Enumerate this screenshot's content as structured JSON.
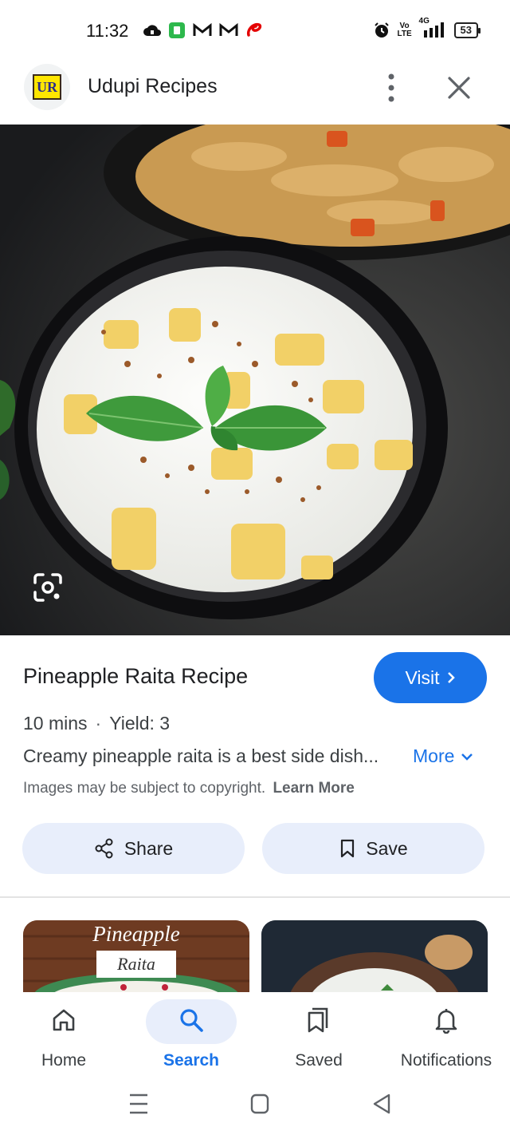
{
  "status_bar": {
    "time": "11:32",
    "notification_icons": [
      "cloud-upload-icon",
      "green-app-icon",
      "gmail-icon",
      "gmail-icon",
      "airtel-icon"
    ],
    "right_icons": [
      "alarm-icon",
      "volte-icon",
      "4g-signal-icon"
    ],
    "volte": "Vo LTE",
    "network": "4G",
    "battery": "53"
  },
  "header": {
    "logo_text": "UR",
    "site_name": "Udupi Recipes",
    "menu_icon": "more-vert-icon",
    "close_icon": "close-icon"
  },
  "hero": {
    "lens_icon": "google-lens-icon"
  },
  "recipe": {
    "title": "Pineapple Raita Recipe",
    "visit_label": "Visit",
    "time": "10 mins",
    "separator": "·",
    "yield": "Yield: 3",
    "description": "Creamy pineapple raita is a best side dish...",
    "more_label": "More",
    "copyright_text": "Images may be subject to copyright.",
    "learn_more": "Learn More"
  },
  "actions": {
    "share_label": "Share",
    "save_label": "Save"
  },
  "related": {
    "thumb1_title": "Pineapple",
    "thumb1_subtitle": "Raita"
  },
  "bottom_nav": {
    "items": [
      {
        "label": "Home",
        "icon": "home-icon"
      },
      {
        "label": "Search",
        "icon": "search-icon"
      },
      {
        "label": "Saved",
        "icon": "saved-icon"
      },
      {
        "label": "Notifications",
        "icon": "bell-icon"
      }
    ],
    "active": "Search"
  },
  "colors": {
    "accent": "#1a73e8",
    "pill_bg": "#e8eefb"
  }
}
